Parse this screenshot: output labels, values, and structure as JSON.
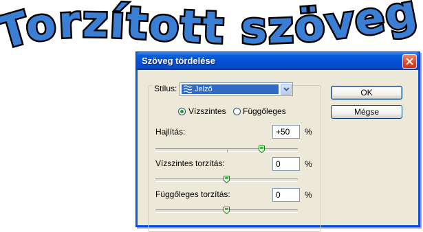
{
  "banner": {
    "text": "Torzított szöveg",
    "color": "#3a7fd4",
    "outline": "#000000"
  },
  "dialog": {
    "title": "Szöveg tördelése",
    "style_label": "Stílus:",
    "style_value": "Jelző",
    "orientation": {
      "horizontal_label": "Vízszintes",
      "vertical_label": "Függőleges",
      "selected": "horizontal"
    },
    "bend": {
      "label": "Hajlítás:",
      "value": "+50",
      "unit": "%",
      "level": 0.75
    },
    "horizontal_distortion": {
      "label": "Vízszintes torzítás:",
      "value": "0",
      "unit": "%",
      "level": 0.5
    },
    "vertical_distortion": {
      "label": "Függőleges torzítás:",
      "value": "0",
      "unit": "%",
      "level": 0.5
    },
    "ok_label": "OK",
    "cancel_label": "Mégse"
  }
}
